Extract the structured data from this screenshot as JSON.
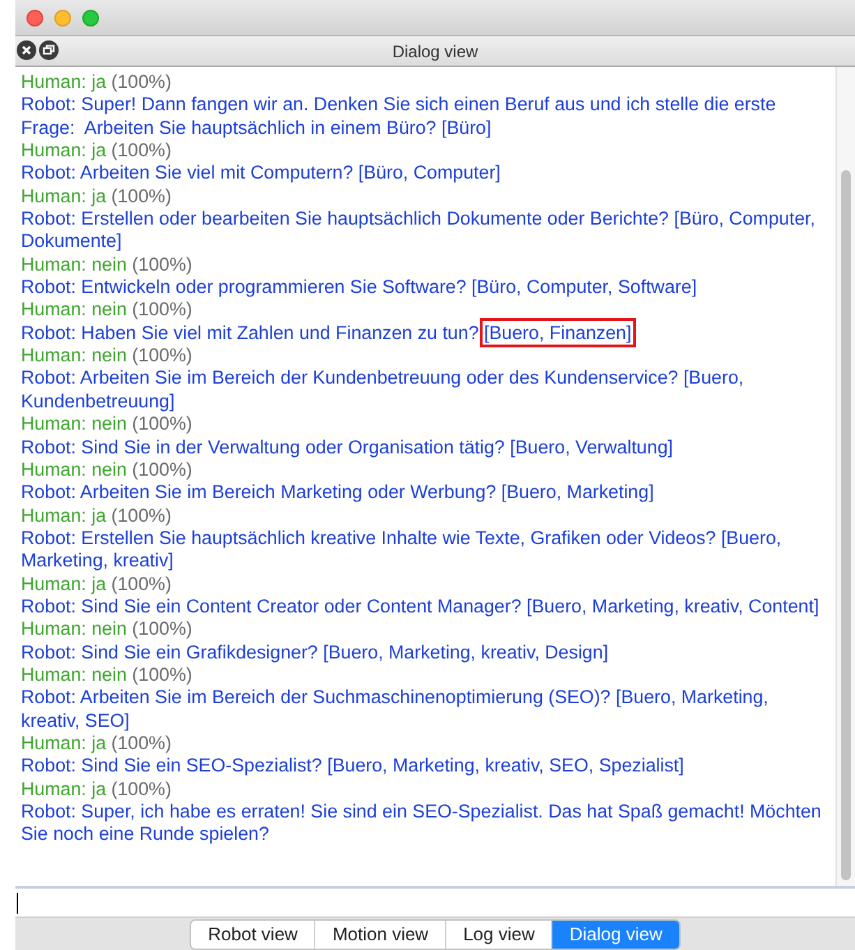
{
  "window": {
    "title": "Dialog view"
  },
  "messages": [
    {
      "kind": "human",
      "text": "Human: ja",
      "confidence": "(100%)"
    },
    {
      "kind": "robot",
      "text": "Robot: Super! Dann fangen wir an. Denken Sie sich einen Beruf aus und ich stelle die erste Frage:  Arbeiten Sie hauptsächlich in einem Büro?",
      "tags": "[Büro]",
      "highlighted": false
    },
    {
      "kind": "human",
      "text": "Human: ja",
      "confidence": "(100%)"
    },
    {
      "kind": "robot",
      "text": "Robot: Arbeiten Sie viel mit Computern?",
      "tags": "[Büro, Computer]",
      "highlighted": false
    },
    {
      "kind": "human",
      "text": "Human: ja",
      "confidence": "(100%)"
    },
    {
      "kind": "robot",
      "text": "Robot: Erstellen oder bearbeiten Sie hauptsächlich Dokumente oder Berichte?",
      "tags": "[Büro, Computer, Dokumente]",
      "highlighted": false
    },
    {
      "kind": "human",
      "text": "Human: nein",
      "confidence": "(100%)"
    },
    {
      "kind": "robot",
      "text": "Robot: Entwickeln oder programmieren Sie Software?",
      "tags": "[Büro, Computer, Software]",
      "highlighted": false
    },
    {
      "kind": "human",
      "text": "Human: nein",
      "confidence": "(100%)"
    },
    {
      "kind": "robot",
      "text": "Robot: Haben Sie viel mit Zahlen und Finanzen zu tun?",
      "tags": "[Buero, Finanzen]",
      "highlighted": true
    },
    {
      "kind": "human",
      "text": "Human: nein",
      "confidence": "(100%)"
    },
    {
      "kind": "robot",
      "text": "Robot: Arbeiten Sie im Bereich der Kundenbetreuung oder des Kundenservice?",
      "tags": "[Buero, Kundenbetreuung]",
      "highlighted": false
    },
    {
      "kind": "human",
      "text": "Human: nein",
      "confidence": "(100%)"
    },
    {
      "kind": "robot",
      "text": "Robot: Sind Sie in der Verwaltung oder Organisation tätig?",
      "tags": "[Buero, Verwaltung]",
      "highlighted": false
    },
    {
      "kind": "human",
      "text": "Human: nein",
      "confidence": "(100%)"
    },
    {
      "kind": "robot",
      "text": "Robot: Arbeiten Sie im Bereich Marketing oder Werbung?",
      "tags": "[Buero, Marketing]",
      "highlighted": false
    },
    {
      "kind": "human",
      "text": "Human: ja",
      "confidence": "(100%)"
    },
    {
      "kind": "robot",
      "text": "Robot: Erstellen Sie hauptsächlich kreative Inhalte wie Texte, Grafiken oder Videos?",
      "tags": "[Buero, Marketing, kreativ]",
      "highlighted": false
    },
    {
      "kind": "human",
      "text": "Human: ja",
      "confidence": "(100%)"
    },
    {
      "kind": "robot",
      "text": "Robot: Sind Sie ein Content Creator oder Content Manager?",
      "tags": "[Buero, Marketing, kreativ, Content]",
      "highlighted": false
    },
    {
      "kind": "human",
      "text": "Human: nein",
      "confidence": "(100%)"
    },
    {
      "kind": "robot",
      "text": "Robot: Sind Sie ein Grafikdesigner?",
      "tags": "[Buero, Marketing, kreativ, Design]",
      "highlighted": false
    },
    {
      "kind": "human",
      "text": "Human: nein",
      "confidence": "(100%)"
    },
    {
      "kind": "robot",
      "text": "Robot: Arbeiten Sie im Bereich der Suchmaschinenoptimierung (SEO)?",
      "tags": "[Buero, Marketing, kreativ, SEO]",
      "highlighted": false
    },
    {
      "kind": "human",
      "text": "Human: ja",
      "confidence": "(100%)"
    },
    {
      "kind": "robot",
      "text": "Robot: Sind Sie ein SEO-Spezialist?",
      "tags": "[Buero, Marketing, kreativ, SEO, Spezialist]",
      "highlighted": false
    },
    {
      "kind": "human",
      "text": "Human: ja",
      "confidence": "(100%)"
    },
    {
      "kind": "robot",
      "text": "Robot: Super, ich habe es erraten! Sie sind ein SEO-Spezialist. Das hat Spaß gemacht! Möchten Sie noch eine Runde spielen?"
    }
  ],
  "tabs": [
    {
      "label": "Robot view",
      "selected": false
    },
    {
      "label": "Motion view",
      "selected": false
    },
    {
      "label": "Log view",
      "selected": false
    },
    {
      "label": "Dialog view",
      "selected": true
    }
  ]
}
